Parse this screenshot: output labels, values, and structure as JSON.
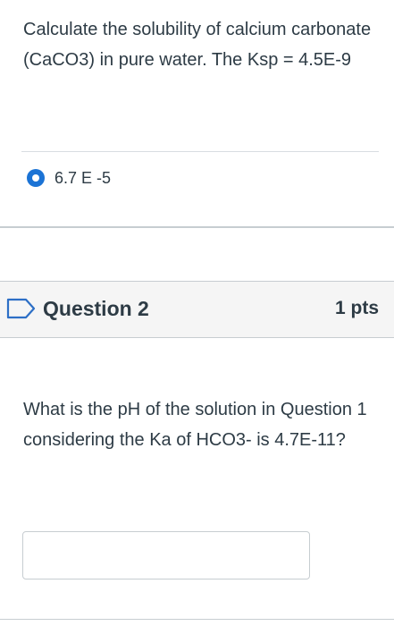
{
  "question1": {
    "text": "Calculate the solubility of calcium carbonate (CaCO3) in pure water. The Ksp = 4.5E-9",
    "selected_answer": "6.7 E -5",
    "selected": true
  },
  "question2": {
    "title": "Question 2",
    "points": "1 pts",
    "flag_icon": "flag-outline-icon",
    "text": "What is the pH of the solution in Question 1 considering the Ka of HCO3- is 4.7E-11?",
    "answer_value": "",
    "answer_placeholder": ""
  },
  "colors": {
    "radio_selected": "#1b73d5",
    "text": "#2d3b45",
    "header_bg": "#f5f5f5",
    "border": "#c7cdd1"
  }
}
